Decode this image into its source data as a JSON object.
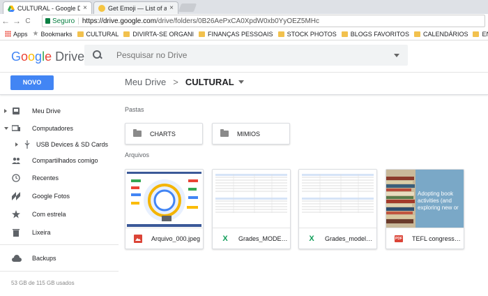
{
  "browser": {
    "tabs": [
      {
        "title": "CULTURAL - Google Driv",
        "close": "×",
        "active": true
      },
      {
        "title": "Get Emoji — List of a",
        "close": "×",
        "active": false
      }
    ],
    "nav": {
      "back": "←",
      "forward": "→",
      "reload": "C"
    },
    "security_label": "Seguro",
    "url_base": "https://drive.google.com",
    "url_path": "/drive/folders/0B26AePxCA0XpdW0xb0YyOEZ5MHc",
    "bookmarks": [
      "Apps",
      "Bookmarks",
      "CULTURAL",
      "DIVIRTA-SE ORGANI",
      "FINANÇAS PESSOAIS",
      "STOCK PHOTOS",
      "BLOGS FAVORITOS",
      "CALENDÁRIOS",
      "ENTRETENIMENTO"
    ]
  },
  "header": {
    "logo_google": [
      "G",
      "o",
      "o",
      "g",
      "l",
      "e"
    ],
    "logo_drive": "Drive",
    "search_placeholder": "Pesquisar no Drive"
  },
  "toolbar": {
    "new_label": "NOVO",
    "breadcrumb_root": "Meu Drive",
    "breadcrumb_sep": ">",
    "breadcrumb_current": "CULTURAL"
  },
  "sidebar": {
    "items": [
      {
        "label": "Meu Drive",
        "icon": "my-drive-icon"
      },
      {
        "label": "Computadores",
        "icon": "computers-icon"
      },
      {
        "label": "USB Devices & SD Cards",
        "icon": "usb-icon"
      },
      {
        "label": "Compartilhados comigo",
        "icon": "shared-icon"
      },
      {
        "label": "Recentes",
        "icon": "clock-icon"
      },
      {
        "label": "Google Fotos",
        "icon": "photos-icon"
      },
      {
        "label": "Com estrela",
        "icon": "star-icon"
      },
      {
        "label": "Lixeira",
        "icon": "trash-icon"
      },
      {
        "label": "Backups",
        "icon": "cloud-icon"
      }
    ],
    "storage": "53 GB de 115 GB usados"
  },
  "main": {
    "folders_label": "Pastas",
    "folders": [
      "CHARTS",
      "MIMIOS"
    ],
    "files_label": "Arquivos",
    "files": [
      {
        "name": "Arquivo_000.jpeg",
        "type": "image",
        "badge": ""
      },
      {
        "name": "Grades_MODELO.xlsx",
        "type": "sheet",
        "badge": "X"
      },
      {
        "name": "Grades_modelo.xlsx",
        "type": "sheet",
        "badge": "X"
      },
      {
        "name": "TEFL congress presentation.pdf",
        "type": "pdf",
        "badge": "PDF"
      }
    ],
    "pdf_thumb_text": "Adopting book activities (and exploring new or"
  },
  "colors": {
    "accent": "#4285f4",
    "sheet_green": "#0f9d58",
    "pdf_red": "#db4437",
    "image_red": "#db4437"
  }
}
